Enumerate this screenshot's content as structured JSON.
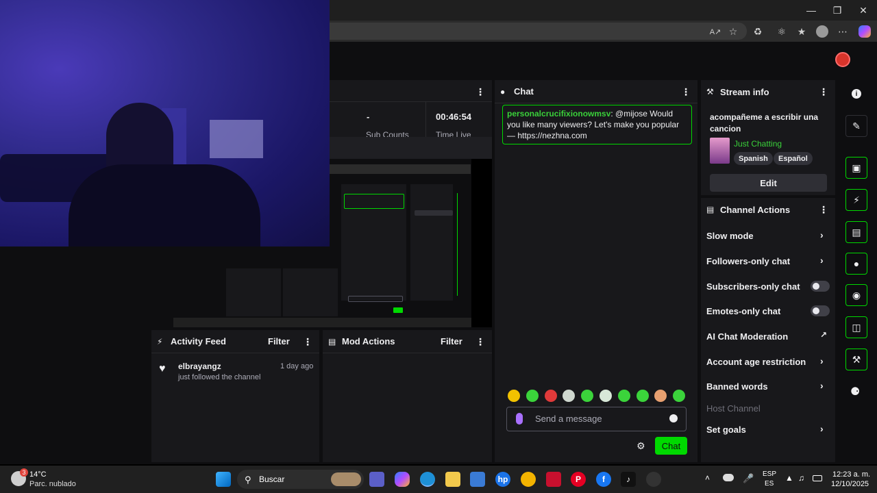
{
  "browser": {
    "read_aloud_label": "A↗"
  },
  "stats": {
    "col1_value": "-",
    "col1_label": "Sub Counts",
    "col2_value": "00:46:54",
    "col2_label": "Time Live"
  },
  "activity_feed": {
    "title": "Activity Feed",
    "filter_label": "Filter",
    "items": [
      {
        "user": "elbrayangz",
        "time": "1 day ago",
        "text": "just followed the channel"
      }
    ]
  },
  "mod_actions": {
    "title": "Mod Actions",
    "filter_label": "Filter"
  },
  "chat": {
    "title": "Chat",
    "messages": [
      {
        "user": "personalcrucifixionowmsv",
        "text": ": @mijose Would you like many viewers? Let's make you popular — https://nezhna.com"
      }
    ],
    "input_placeholder": "Send a message",
    "send_label": "Chat"
  },
  "stream_info": {
    "title": "Stream info",
    "stream_title": "acompañeme a escribir una cancion",
    "category": "Just Chatting",
    "tags": [
      "Spanish",
      "Español"
    ],
    "edit_label": "Edit"
  },
  "channel_actions": {
    "title": "Channel Actions",
    "items": [
      {
        "label": "Slow mode",
        "kind": "chevron"
      },
      {
        "label": "Followers-only chat",
        "kind": "chevron"
      },
      {
        "label": "Subscribers-only chat",
        "kind": "toggle",
        "on": false
      },
      {
        "label": "Emotes-only chat",
        "kind": "toggle",
        "on": false
      },
      {
        "label": "AI Chat Moderation",
        "kind": "external"
      },
      {
        "label": "Account age restriction",
        "kind": "chevron"
      },
      {
        "label": "Banned words",
        "kind": "chevron"
      },
      {
        "label": "Host Channel",
        "kind": "disabled"
      },
      {
        "label": "Set goals",
        "kind": "chevron"
      }
    ]
  },
  "taskbar": {
    "weather_temp": "14°C",
    "weather_desc": "Parc. nublado",
    "weather_badge": "3",
    "search_label": "Buscar",
    "lang_top": "ESP",
    "lang_bottom": "ES",
    "time": "12:23 a. m.",
    "date": "12/10/2025"
  },
  "colors": {
    "accent": "#00d900",
    "panel": "#18181b",
    "background": "#0e0e10"
  }
}
